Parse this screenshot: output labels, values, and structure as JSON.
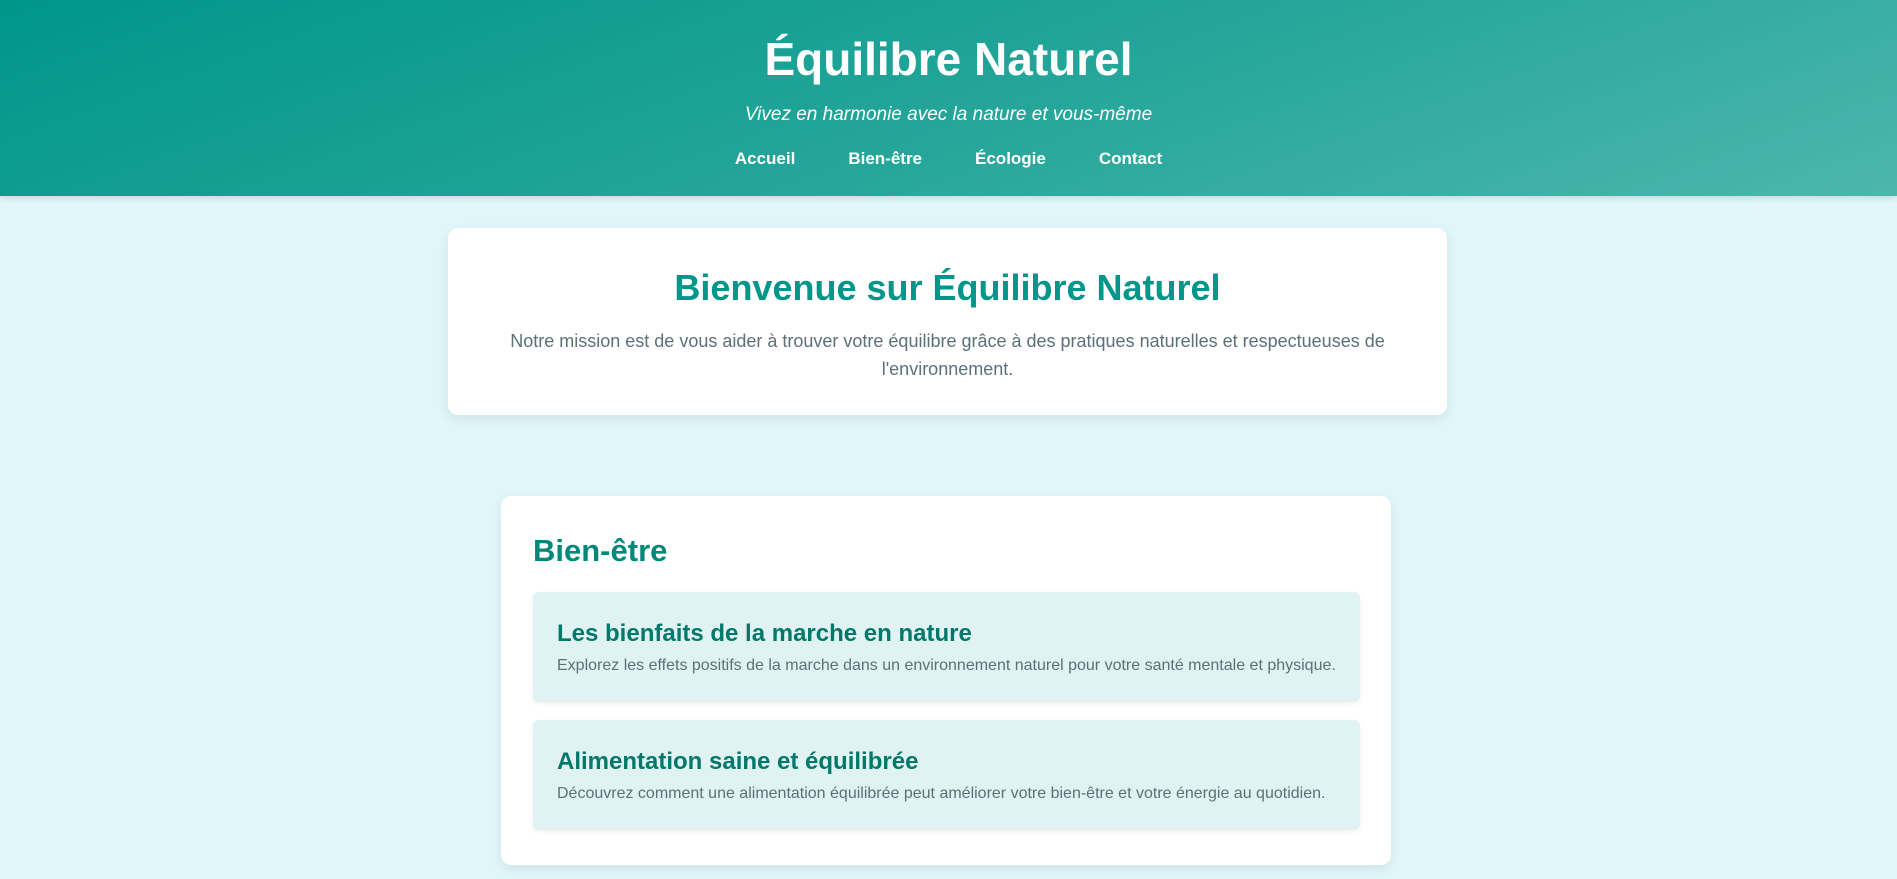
{
  "header": {
    "title": "Équilibre Naturel",
    "tagline": "Vivez en harmonie avec la nature et vous-même",
    "nav": [
      {
        "label": "Accueil"
      },
      {
        "label": "Bien-être"
      },
      {
        "label": "Écologie"
      },
      {
        "label": "Contact"
      }
    ]
  },
  "welcome": {
    "title": "Bienvenue sur Équilibre Naturel",
    "text": "Notre mission est de vous aider à trouver votre équilibre grâce à des pratiques naturelles et respectueuses de l'environnement."
  },
  "section": {
    "title": "Bien-être",
    "articles": [
      {
        "title": "Les bienfaits de la marche en nature",
        "text": "Explorez les effets positifs de la marche dans un environnement naturel pour votre santé mentale et physique."
      },
      {
        "title": "Alimentation saine et équilibrée",
        "text": "Découvrez comment une alimentation équilibrée peut améliorer votre bien-être et votre énergie au quotidien."
      }
    ]
  },
  "colors": {
    "header_gradient_start": "#00968a",
    "header_gradient_end": "#4db6ac",
    "page_background": "#e0f6f8",
    "heading_teal": "#00968a",
    "article_background": "#e0f2f1",
    "body_text": "#5b7078"
  }
}
